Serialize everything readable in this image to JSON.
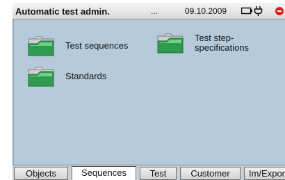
{
  "header": {
    "title": "Automatic test admin.",
    "dots": "...",
    "date": "09.10.2009",
    "icons": [
      "battery-icon",
      "plug-icon",
      "stop-icon"
    ]
  },
  "items": [
    {
      "label": "Test sequences",
      "icon": "folder-icon"
    },
    {
      "label": "Test step-\nspecifications",
      "icon": "folder-icon"
    },
    {
      "label": "Standards",
      "icon": "folder-icon"
    }
  ],
  "tabs": [
    {
      "label": "Objects",
      "active": false
    },
    {
      "label": "Sequences",
      "active": true
    },
    {
      "label": "Test",
      "active": false
    },
    {
      "label": "Customer",
      "active": false
    },
    {
      "label": "Im/Expor",
      "active": false
    }
  ],
  "colors": {
    "workspace": "#b5cbdc",
    "folder_green": "#2e9b4e",
    "stop_red": "#d32020"
  }
}
